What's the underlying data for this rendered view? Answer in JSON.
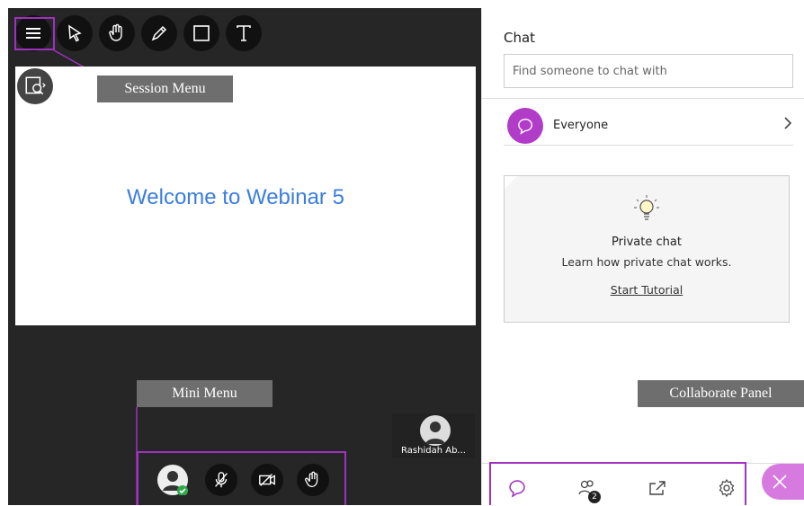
{
  "toolbar": {
    "icons": [
      "menu-icon",
      "pointer-icon",
      "hand-icon",
      "pencil-icon",
      "rectangle-icon",
      "text-icon"
    ]
  },
  "slide": {
    "title": "Welcome to Webinar 5"
  },
  "callouts": {
    "session_menu": "Session Menu",
    "mini_menu": "Mini Menu",
    "collaborate_panel": "Collaborate Panel"
  },
  "participant": {
    "name": "Rashidah Ab..."
  },
  "chat": {
    "title": "Chat",
    "search_placeholder": "Find someone to chat with",
    "everyone_label": "Everyone",
    "private_title": "Private chat",
    "private_desc": "Learn how private chat works.",
    "tutorial_link": "Start Tutorial"
  },
  "panel": {
    "attendee_count": "2"
  },
  "colors": {
    "highlight": "#a030c0",
    "accent": "#b03cc8",
    "slide_text": "#3b7ddd"
  }
}
